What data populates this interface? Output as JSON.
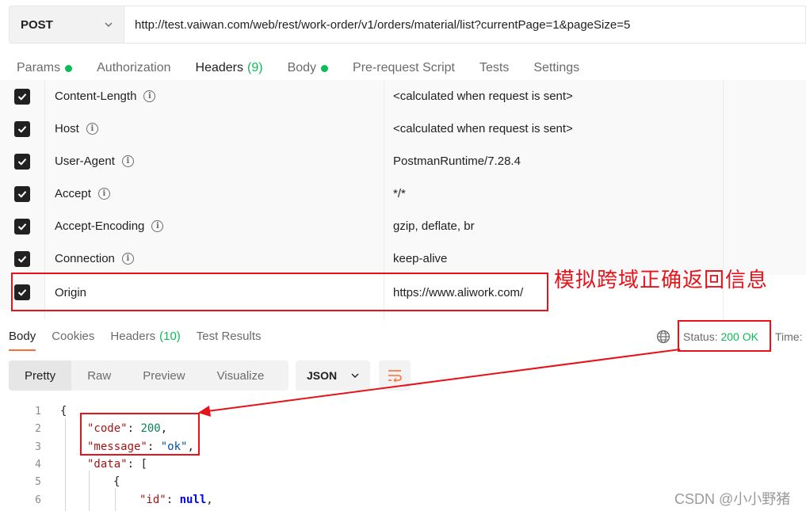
{
  "request": {
    "method": "POST",
    "url": "http://test.vaiwan.com/web/rest/work-order/v1/orders/material/list?currentPage=1&pageSize=5"
  },
  "request_tabs": [
    {
      "label": "Params",
      "dot": true
    },
    {
      "label": "Authorization",
      "dot": false
    },
    {
      "label": "Headers",
      "count": "(9)",
      "active": true
    },
    {
      "label": "Body",
      "dot": true
    },
    {
      "label": "Pre-request Script",
      "dot": false
    },
    {
      "label": "Tests",
      "dot": false
    },
    {
      "label": "Settings",
      "dot": false
    }
  ],
  "headers": [
    {
      "key": "Content-Length",
      "value": "<calculated when request is sent>",
      "checked": true
    },
    {
      "key": "Host",
      "value": "<calculated when request is sent>",
      "checked": true
    },
    {
      "key": "User-Agent",
      "value": "PostmanRuntime/7.28.4",
      "checked": true
    },
    {
      "key": "Accept",
      "value": "*/*",
      "checked": true
    },
    {
      "key": "Accept-Encoding",
      "value": "gzip, deflate, br",
      "checked": true
    },
    {
      "key": "Connection",
      "value": "keep-alive",
      "checked": true
    },
    {
      "key": "Origin",
      "value": "https://www.aliwork.com/",
      "checked": true
    }
  ],
  "annotation": "模拟跨域正确返回信息",
  "response_tabs": [
    {
      "label": "Body",
      "active": true
    },
    {
      "label": "Cookies"
    },
    {
      "label": "Headers",
      "count": "(10)"
    },
    {
      "label": "Test Results"
    }
  ],
  "status": {
    "label": "Status:",
    "value": "200 OK",
    "time_label": "Time:"
  },
  "view_modes": [
    "Pretty",
    "Raw",
    "Preview",
    "Visualize"
  ],
  "format": "JSON",
  "code_lines": [
    "1",
    "2",
    "3",
    "4",
    "5",
    "6"
  ],
  "code": {
    "line1": "{",
    "code_key": "\"code\"",
    "code_val": "200",
    "message_key": "\"message\"",
    "message_val": "\"ok\"",
    "data_key": "\"data\"",
    "data_open": "[",
    "obj_open": "{",
    "id_key": "\"id\"",
    "id_val": "null"
  },
  "watermark": "CSDN @小小野猪",
  "colors": {
    "accent": "#ff6c37",
    "success": "#0cbb52",
    "annotation": "#e8121b"
  }
}
